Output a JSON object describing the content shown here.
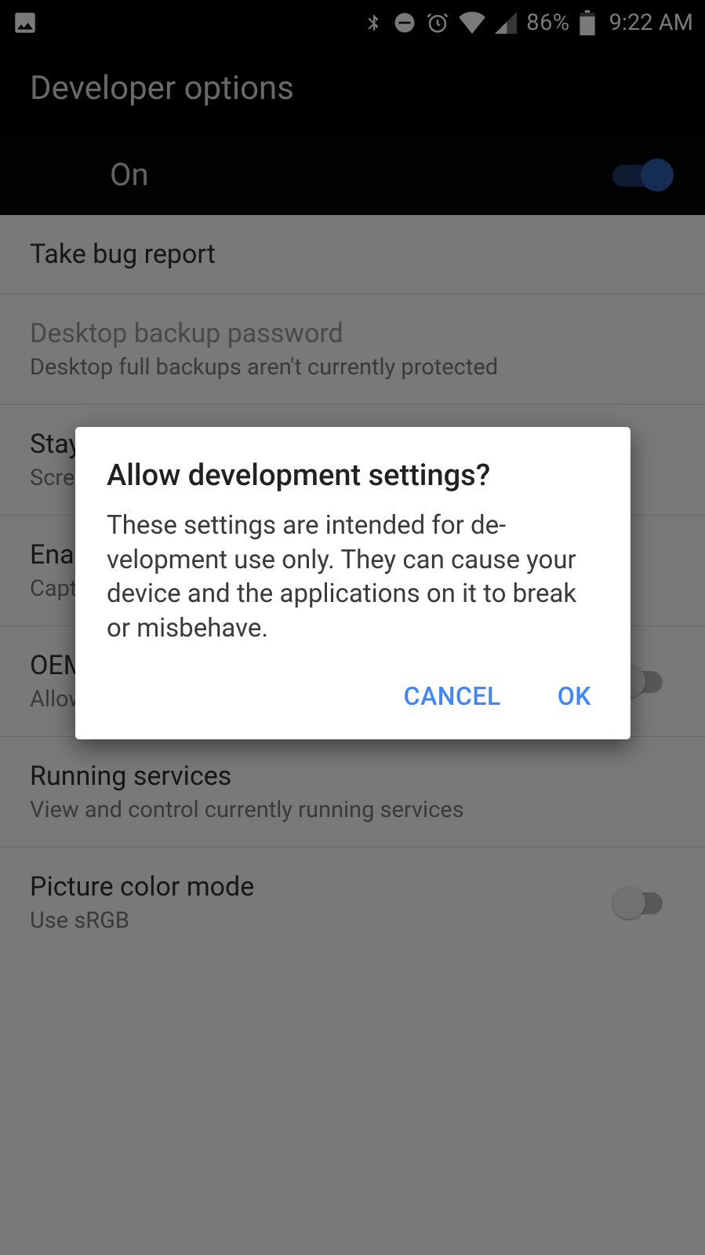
{
  "statusbar": {
    "battery_pct": "86%",
    "time": "9:22 AM"
  },
  "header": {
    "title": "Developer options"
  },
  "master": {
    "label": "On",
    "enabled": true
  },
  "rows": [
    {
      "title": "Take bug report",
      "subtitle": "",
      "has_switch": false
    },
    {
      "title": "Desktop backup password",
      "subtitle": "Desktop full backups aren't currently protected",
      "has_switch": false
    },
    {
      "title": "Stay awake",
      "subtitle": "Screen will never sleep while charging",
      "has_switch": false
    },
    {
      "title": "Enable Bluetooth HCI snoop log",
      "subtitle": "Capture all bluetooth HCI packets in a file",
      "has_switch": false
    },
    {
      "title": "OEM unlocking",
      "subtitle": "Allow the bootloader to be unlocked",
      "has_switch": true,
      "switch_on": false
    },
    {
      "title": "Running services",
      "subtitle": "View and control currently running services",
      "has_switch": false
    },
    {
      "title": "Picture color mode",
      "subtitle": "Use sRGB",
      "has_switch": true,
      "switch_on": false
    }
  ],
  "dialog": {
    "title": "Allow development settings?",
    "body": "These settings are intended for de­velopment use only. They can cause your device and the applications on it to break or misbehave.",
    "cancel": "CANCEL",
    "ok": "OK"
  }
}
